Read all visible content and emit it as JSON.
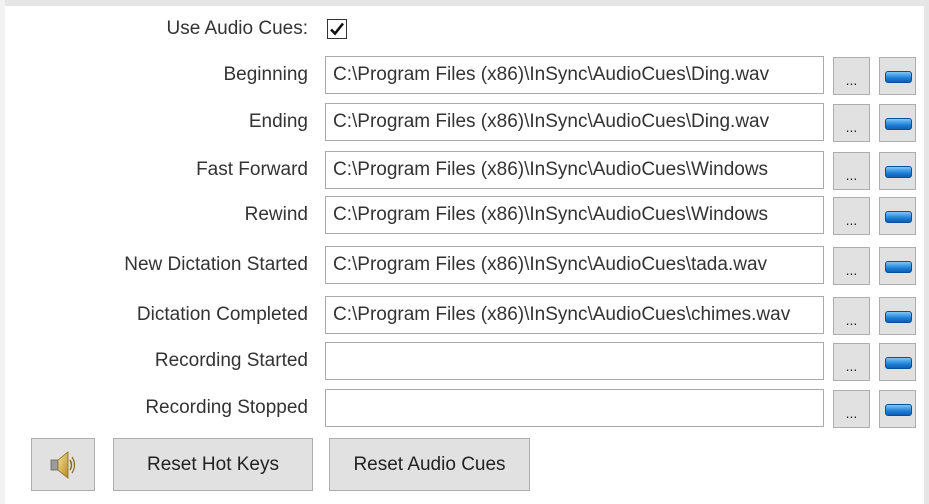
{
  "use_audio_cues": {
    "label": "Use Audio Cues:",
    "checked": true
  },
  "rows": [
    {
      "label": "Beginning",
      "path": "C:\\Program Files (x86)\\InSync\\AudioCues\\Ding.wav",
      "browse_label": "..."
    },
    {
      "label": "Ending",
      "path": "C:\\Program Files (x86)\\InSync\\AudioCues\\Ding.wav",
      "browse_label": "..."
    },
    {
      "label": "Fast Forward",
      "path": "C:\\Program Files (x86)\\InSync\\AudioCues\\Windows",
      "browse_label": "..."
    },
    {
      "label": "Rewind",
      "path": "C:\\Program Files (x86)\\InSync\\AudioCues\\Windows",
      "browse_label": "..."
    },
    {
      "label": "New Dictation Started",
      "path": "C:\\Program Files (x86)\\InSync\\AudioCues\\tada.wav",
      "browse_label": "..."
    },
    {
      "label": "Dictation Completed",
      "path": "C:\\Program Files (x86)\\InSync\\AudioCues\\chimes.wav",
      "browse_label": "..."
    },
    {
      "label": "Recording Started",
      "path": "",
      "browse_label": "..."
    },
    {
      "label": "Recording Stopped",
      "path": "",
      "browse_label": "..."
    }
  ],
  "footer": {
    "speaker_icon": "speaker-icon",
    "reset_hot_keys_label": "Reset Hot Keys",
    "reset_audio_cues_label": "Reset Audio Cues"
  },
  "colors": {
    "play_bar": "#1e7fd8",
    "button_bg": "#e1e1e1"
  }
}
